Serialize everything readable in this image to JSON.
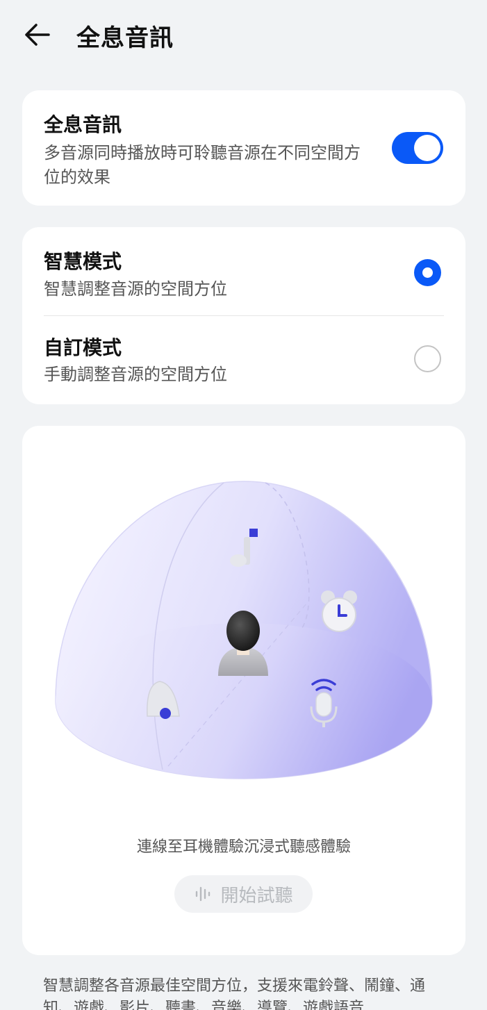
{
  "header": {
    "title": "全息音訊",
    "back_icon": "arrow-left-icon"
  },
  "holographic": {
    "title": "全息音訊",
    "description": "多音源同時播放時可聆聽音源在不同空間方位的效果",
    "enabled": true,
    "accent_color": "#0a59f7"
  },
  "modes": [
    {
      "title": "智慧模式",
      "description": "智慧調整音源的空間方位",
      "selected": true
    },
    {
      "title": "自訂模式",
      "description": "手動調整音源的空間方位",
      "selected": false
    }
  ],
  "illustration": {
    "icons": [
      "music-note-icon",
      "alarm-clock-icon",
      "bell-icon",
      "microphone-icon",
      "user-avatar-icon"
    ],
    "caption": "連線至耳機體驗沉浸式聽感體驗",
    "try_button": {
      "label": "開始試聽",
      "icon": "sound-wave-icon",
      "enabled": false
    }
  },
  "footer": {
    "text": "智慧調整各音源最佳空間方位，支援來電鈴聲、鬧鐘、通知、遊戲、影片、聽書、音樂、導覽、遊戲語音"
  }
}
